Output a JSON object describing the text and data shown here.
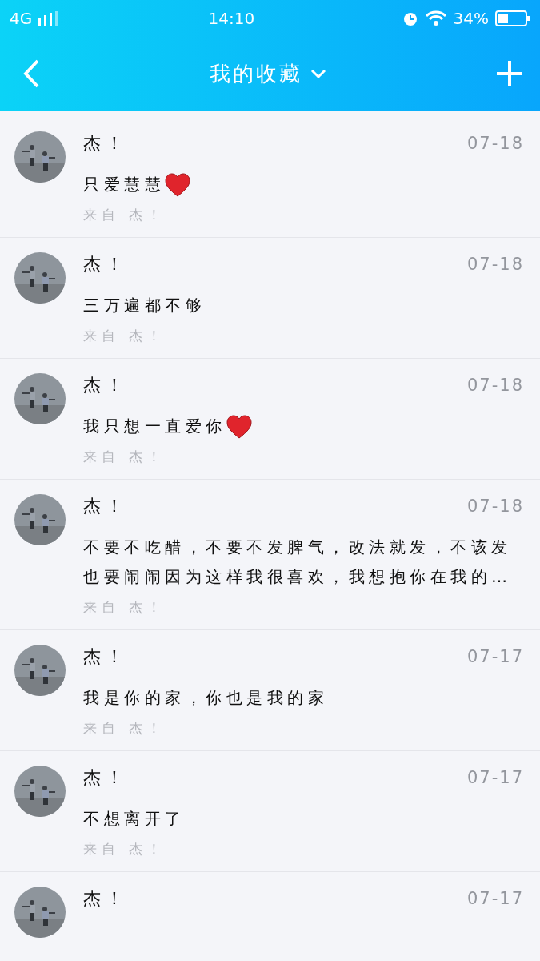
{
  "status_bar": {
    "network": "4G",
    "time": "14:10",
    "battery": "34%"
  },
  "header": {
    "title": "我的收藏"
  },
  "items": [
    {
      "name": "杰！",
      "date": "07-18",
      "text": "只爱慧慧",
      "heart": true,
      "source": "来自 杰！"
    },
    {
      "name": "杰！",
      "date": "07-18",
      "text": "三万遍都不够",
      "heart": false,
      "source": "来自 杰！"
    },
    {
      "name": "杰！",
      "date": "07-18",
      "text": "我只想一直爱你",
      "heart": true,
      "source": "来自 杰！"
    },
    {
      "name": "杰！",
      "date": "07-18",
      "text": "不要不吃醋，不要不发脾气，改法就发，不该发也要闹闹因为这样我很喜欢，我想抱你在我的…",
      "heart": false,
      "source": "来自 杰！"
    },
    {
      "name": "杰！",
      "date": "07-17",
      "text": "我是你的家，你也是我的家",
      "heart": false,
      "source": "来自 杰！"
    },
    {
      "name": "杰！",
      "date": "07-17",
      "text": "不想离开了",
      "heart": false,
      "source": "来自 杰！"
    },
    {
      "name": "杰！",
      "date": "07-17"
    }
  ]
}
